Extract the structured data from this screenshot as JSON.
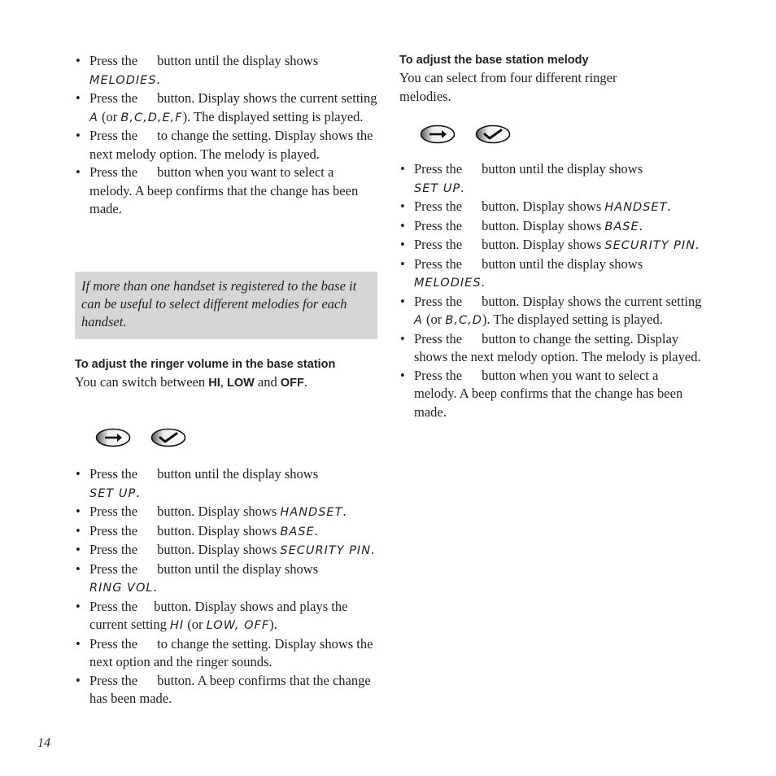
{
  "page_number": "14",
  "left_column": {
    "steps_top": [
      {
        "pre": "Press the",
        "post": "button until the display shows",
        "lcd": "MELODIES",
        "tail": "."
      },
      {
        "pre": "Press the",
        "post": "button. Display shows the current setting",
        "lcd": "A",
        "mid": " (or ",
        "lcd2": "B,C,D,E,F",
        "tail": "). The displayed setting is played."
      },
      {
        "pre": "Press the",
        "post": "to change the setting. Display shows the next melody option. The melody is played."
      },
      {
        "pre": "Press the",
        "post": "button when you want to select a melody. A beep confirms that the change has been made."
      }
    ],
    "note": "If more than one handset is registered to the base it can be useful to select different melodies for each handset.",
    "section_heading": "To adjust the ringer volume in the base station",
    "intro": {
      "pre": "You can switch between ",
      "hi": "HI",
      "sep1": ", ",
      "low": "LOW",
      "sep2": " and ",
      "off": "OFF",
      "tail": "."
    },
    "buttons": [
      {
        "name": "scroll-arrow-button",
        "icon": "arrow-right-icon"
      },
      {
        "name": "ok-check-button",
        "icon": "checkmark-icon"
      }
    ],
    "steps_bottom": [
      {
        "pre": "Press the",
        "post": "button until the display shows",
        "lcd": "SET UP",
        "tail": "."
      },
      {
        "pre": "Press the",
        "post": "button. Display shows",
        "lcd": "HANDSET",
        "tail": "."
      },
      {
        "pre": "Press the",
        "post": "button. Display shows",
        "lcd": "BASE",
        "tail": "."
      },
      {
        "pre": "Press the",
        "post": "button. Display shows",
        "lcd": "SECURITY PIN",
        "tail": "."
      },
      {
        "pre": "Press the",
        "post": "button until the display shows",
        "lcd": "RING VOL",
        "tail": "."
      },
      {
        "pre": "Press the",
        "post": "button. Display shows and plays the current setting",
        "lcd": "HI",
        "mid": " (or ",
        "lcd2": "LOW, OFF",
        "tail": ")."
      },
      {
        "pre": "Press the",
        "post": "to change the setting. Display shows the next option and the ringer sounds."
      },
      {
        "pre": "Press the",
        "post": "button. A beep confirms that the change has been made."
      }
    ]
  },
  "right_column": {
    "section_heading": "To adjust the base station melody",
    "intro": "You can select from four different ringer melodies.",
    "buttons": [
      {
        "name": "scroll-arrow-button",
        "icon": "arrow-right-icon"
      },
      {
        "name": "ok-check-button",
        "icon": "checkmark-icon"
      }
    ],
    "steps": [
      {
        "pre": "Press the",
        "post": "button until the display shows",
        "lcd": "SET UP",
        "tail": "."
      },
      {
        "pre": "Press the",
        "post": "button. Display shows",
        "lcd": "HANDSET",
        "tail": "."
      },
      {
        "pre": "Press the",
        "post": "button. Display shows",
        "lcd": "BASE",
        "tail": "."
      },
      {
        "pre": "Press the",
        "post": "button. Display shows",
        "lcd": "SECURITY PIN",
        "tail": "."
      },
      {
        "pre": "Press the",
        "post": "button until the display shows",
        "lcd": "MELODIES",
        "tail": "."
      },
      {
        "pre": "Press the",
        "post": "button. Display shows the current setting",
        "lcd": "A",
        "mid": " (or ",
        "lcd2": "B,C,D",
        "tail": "). The displayed setting is played."
      },
      {
        "pre": "Press the",
        "post": "button to change the setting. Display shows the next melody option. The melody is played."
      },
      {
        "pre": "Press the",
        "post": "button when you want to select a melody. A beep confirms that the change has been made."
      }
    ]
  }
}
